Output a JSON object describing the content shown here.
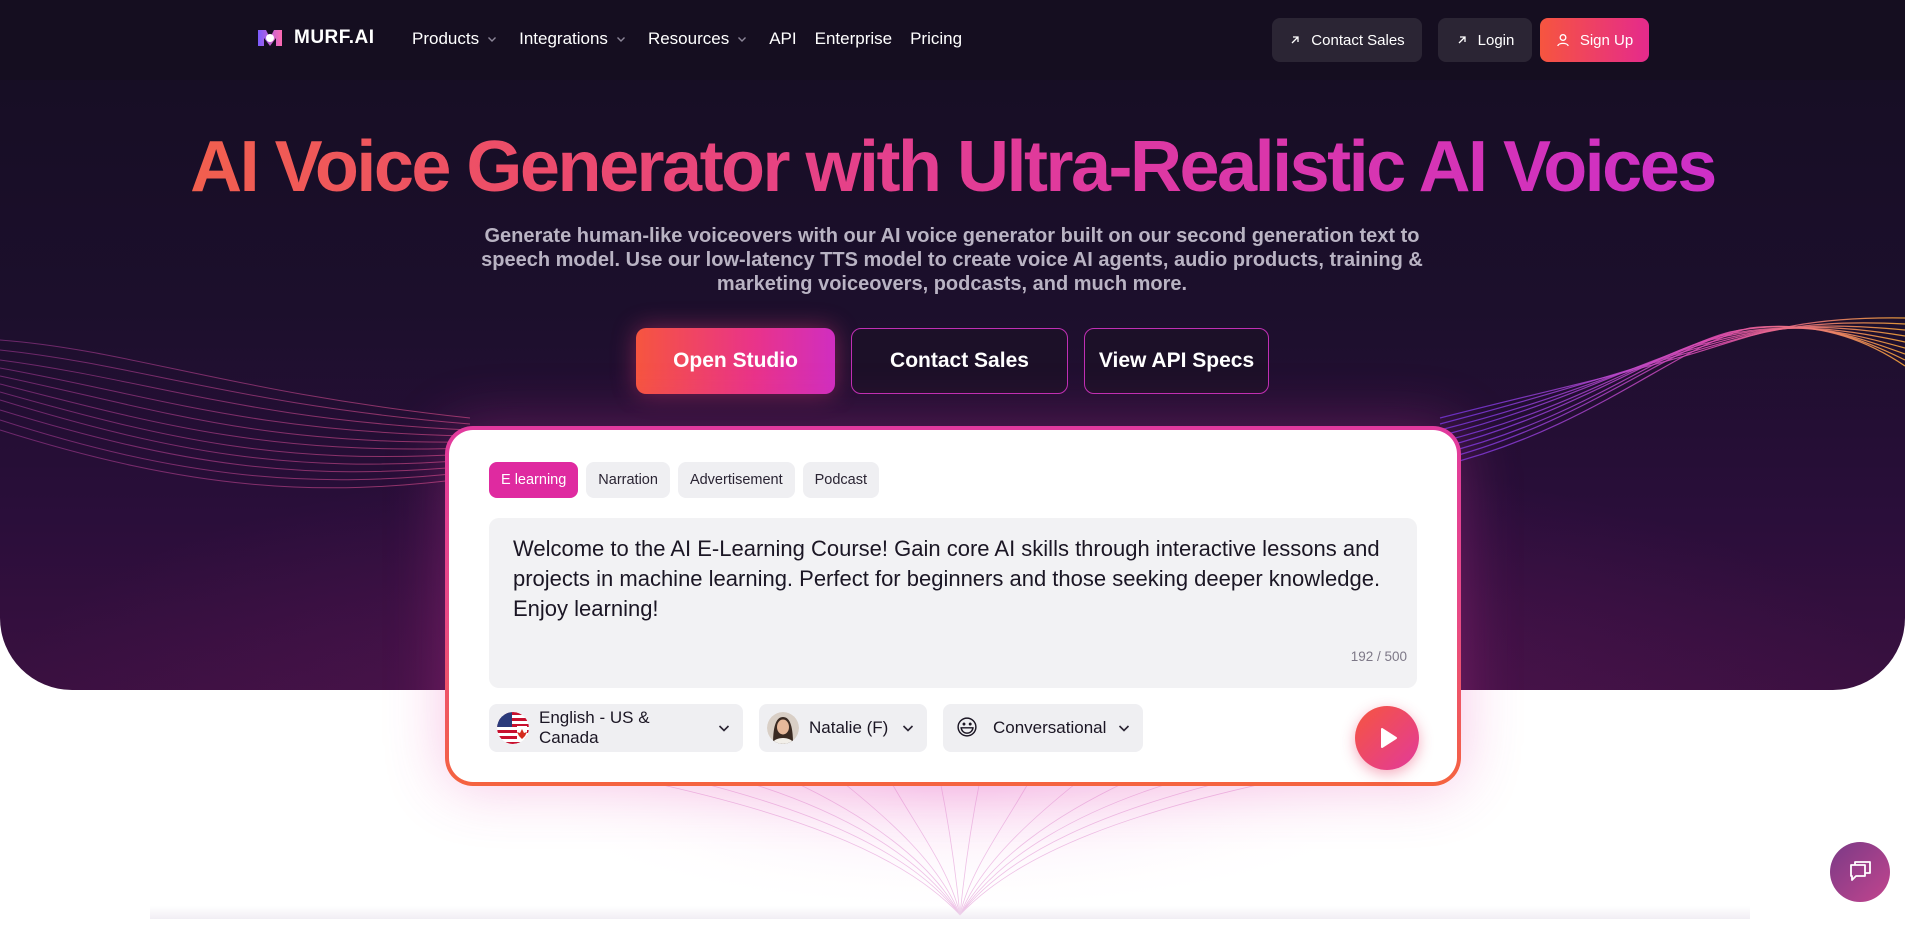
{
  "brand": {
    "name": "MURF.AI"
  },
  "nav": {
    "items": [
      {
        "label": "Products",
        "has_dropdown": true
      },
      {
        "label": "Integrations",
        "has_dropdown": true
      },
      {
        "label": "Resources",
        "has_dropdown": true
      },
      {
        "label": "API",
        "has_dropdown": false
      },
      {
        "label": "Enterprise",
        "has_dropdown": false
      },
      {
        "label": "Pricing",
        "has_dropdown": false
      }
    ],
    "contact_sales": "Contact Sales",
    "login": "Login",
    "signup": "Sign Up"
  },
  "hero": {
    "title": "AI Voice Generator with Ultra-Realistic AI Voices",
    "subtitle": "Generate human-like voiceovers with our AI voice generator built on our second generation text to speech model. Use our low-latency TTS model to create voice AI agents, audio products, training & marketing voiceovers, podcasts, and much more.",
    "buttons": {
      "open_studio": "Open Studio",
      "contact_sales": "Contact Sales",
      "view_api": "View API Specs"
    }
  },
  "demo": {
    "tabs": [
      {
        "label": "E learning",
        "active": true
      },
      {
        "label": "Narration",
        "active": false
      },
      {
        "label": "Advertisement",
        "active": false
      },
      {
        "label": "Podcast",
        "active": false
      }
    ],
    "text": "Welcome to the AI E-Learning Course! Gain core AI skills through interactive lessons and projects in machine learning. Perfect for beginners and those seeking deeper knowledge. Enjoy learning!",
    "counter": "192 / 500",
    "language": "English - US & Canada",
    "voice": "Natalie (F)",
    "style": "Conversational",
    "style_emoji": "😃"
  },
  "colors": {
    "accent_orange": "#f6553f",
    "accent_pink": "#e52a8c",
    "accent_magenta": "#c82cd4",
    "hero_bg": "#1c0f2c"
  },
  "icons": [
    "murf-logo-icon",
    "chevron-down-icon",
    "arrow-up-right-icon",
    "user-icon",
    "us-flag-icon",
    "play-icon",
    "chat-icon"
  ]
}
